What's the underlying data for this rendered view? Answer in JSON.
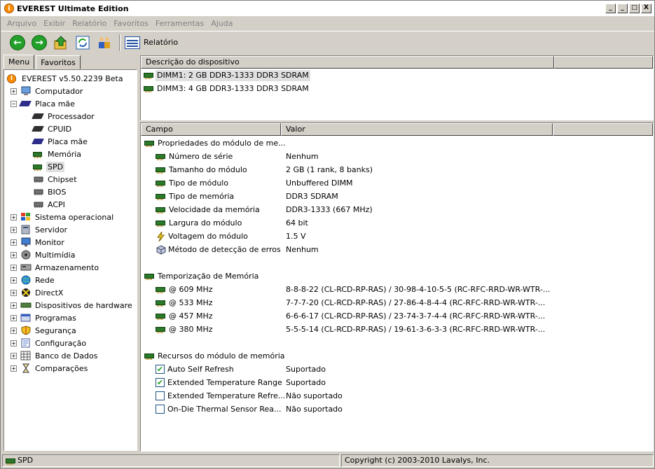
{
  "window": {
    "title": "EVEREST Ultimate Edition",
    "min": "_",
    "restore": "□",
    "close": "X",
    "extra": "_"
  },
  "menu": [
    "Arquivo",
    "Exibir",
    "Relatório",
    "Favoritos",
    "Ferramentas",
    "Ajuda"
  ],
  "toolbar": {
    "report_label": "Relatório"
  },
  "tabs": {
    "menu": "Menu",
    "favorites": "Favoritos"
  },
  "tree": [
    {
      "label": "EVEREST v5.50.2239 Beta",
      "level": 0,
      "icon": "info-icon"
    },
    {
      "label": "Computador",
      "level": 1,
      "exp": "+",
      "icon": "computer-icon"
    },
    {
      "label": "Placa mãe",
      "level": 1,
      "exp": "-",
      "icon": "motherboard-icon"
    },
    {
      "label": "Processador",
      "level": 2,
      "icon": "cpu-icon"
    },
    {
      "label": "CPUID",
      "level": 2,
      "icon": "cpu-icon"
    },
    {
      "label": "Placa mãe",
      "level": 2,
      "icon": "motherboard-icon"
    },
    {
      "label": "Memória",
      "level": 2,
      "icon": "memory-icon"
    },
    {
      "label": "SPD",
      "level": 2,
      "icon": "memory-icon",
      "selected": true
    },
    {
      "label": "Chipset",
      "level": 2,
      "icon": "chip-icon"
    },
    {
      "label": "BIOS",
      "level": 2,
      "icon": "chip-icon"
    },
    {
      "label": "ACPI",
      "level": 2,
      "icon": "chip-icon"
    },
    {
      "label": "Sistema operacional",
      "level": 1,
      "exp": "+",
      "icon": "windows-icon"
    },
    {
      "label": "Servidor",
      "level": 1,
      "exp": "+",
      "icon": "server-icon"
    },
    {
      "label": "Monitor",
      "level": 1,
      "exp": "+",
      "icon": "monitor-icon"
    },
    {
      "label": "Multimídia",
      "level": 1,
      "exp": "+",
      "icon": "speaker-icon"
    },
    {
      "label": "Armazenamento",
      "level": 1,
      "exp": "+",
      "icon": "storage-icon"
    },
    {
      "label": "Rede",
      "level": 1,
      "exp": "+",
      "icon": "network-icon"
    },
    {
      "label": "DirectX",
      "level": 1,
      "exp": "+",
      "icon": "directx-icon"
    },
    {
      "label": "Dispositivos de hardware",
      "level": 1,
      "exp": "+",
      "icon": "hardware-icon"
    },
    {
      "label": "Programas",
      "level": 1,
      "exp": "+",
      "icon": "programs-icon"
    },
    {
      "label": "Segurança",
      "level": 1,
      "exp": "+",
      "icon": "shield-icon"
    },
    {
      "label": "Configuração",
      "level": 1,
      "exp": "+",
      "icon": "config-icon"
    },
    {
      "label": "Banco de Dados",
      "level": 1,
      "exp": "+",
      "icon": "database-icon"
    },
    {
      "label": "Comparações",
      "level": 1,
      "exp": "+",
      "icon": "hourglass-icon"
    }
  ],
  "devices": {
    "header": "Descrição do dispositivo",
    "rows": [
      {
        "label": "DIMM1: 2 GB DDR3-1333 DDR3 SDRAM",
        "selected": true
      },
      {
        "label": "DIMM3: 4 GB DDR3-1333 DDR3 SDRAM"
      }
    ]
  },
  "props": {
    "header_field": "Campo",
    "header_value": "Valor",
    "rows": [
      {
        "kind": "group",
        "field": "Propriedades do módulo de me...",
        "icon": "memory-icon"
      },
      {
        "kind": "item",
        "field": "Número de série",
        "value": "Nenhum",
        "icon": "memory-icon"
      },
      {
        "kind": "item",
        "field": "Tamanho do módulo",
        "value": "2 GB (1 rank, 8 banks)",
        "icon": "memory-icon"
      },
      {
        "kind": "item",
        "field": "Tipo de módulo",
        "value": "Unbuffered DIMM",
        "icon": "memory-icon"
      },
      {
        "kind": "item",
        "field": "Tipo de memória",
        "value": "DDR3 SDRAM",
        "icon": "memory-icon"
      },
      {
        "kind": "item",
        "field": "Velocidade da memória",
        "value": "DDR3-1333 (667 MHz)",
        "icon": "memory-icon"
      },
      {
        "kind": "item",
        "field": "Largura do módulo",
        "value": "64 bit",
        "icon": "memory-icon"
      },
      {
        "kind": "item",
        "field": "Voltagem do módulo",
        "value": "1.5 V",
        "icon": "voltage-icon"
      },
      {
        "kind": "item",
        "field": "Método de detecção de erros",
        "value": "Nenhum",
        "icon": "cube-icon"
      },
      {
        "kind": "blank"
      },
      {
        "kind": "group",
        "field": "Temporização de Memória",
        "icon": "memory-icon"
      },
      {
        "kind": "item",
        "field": "@ 609 MHz",
        "value": "8-8-8-22  (CL-RCD-RP-RAS) / 30-98-4-10-5-5  (RC-RFC-RRD-WR-WTR-...",
        "icon": "memory-icon"
      },
      {
        "kind": "item",
        "field": "@ 533 MHz",
        "value": "7-7-7-20  (CL-RCD-RP-RAS) / 27-86-4-8-4-4  (RC-RFC-RRD-WR-WTR-...",
        "icon": "memory-icon"
      },
      {
        "kind": "item",
        "field": "@ 457 MHz",
        "value": "6-6-6-17  (CL-RCD-RP-RAS) / 23-74-3-7-4-4  (RC-RFC-RRD-WR-WTR-...",
        "icon": "memory-icon"
      },
      {
        "kind": "item",
        "field": "@ 380 MHz",
        "value": "5-5-5-14  (CL-RCD-RP-RAS) / 19-61-3-6-3-3  (RC-RFC-RRD-WR-WTR-...",
        "icon": "memory-icon"
      },
      {
        "kind": "blank"
      },
      {
        "kind": "group",
        "field": "Recursos do módulo de memória",
        "icon": "memory-icon"
      },
      {
        "kind": "check",
        "field": "Auto Self Refresh",
        "value": "Suportado",
        "checked": true
      },
      {
        "kind": "check",
        "field": "Extended Temperature Range",
        "value": "Suportado",
        "checked": true
      },
      {
        "kind": "check",
        "field": "Extended Temperature Refre...",
        "value": "Não suportado",
        "checked": false
      },
      {
        "kind": "check",
        "field": "On-Die Thermal Sensor Rea...",
        "value": "Não suportado",
        "checked": false
      }
    ]
  },
  "status": {
    "left": "SPD",
    "right": "Copyright (c) 2003-2010 Lavalys, Inc."
  }
}
